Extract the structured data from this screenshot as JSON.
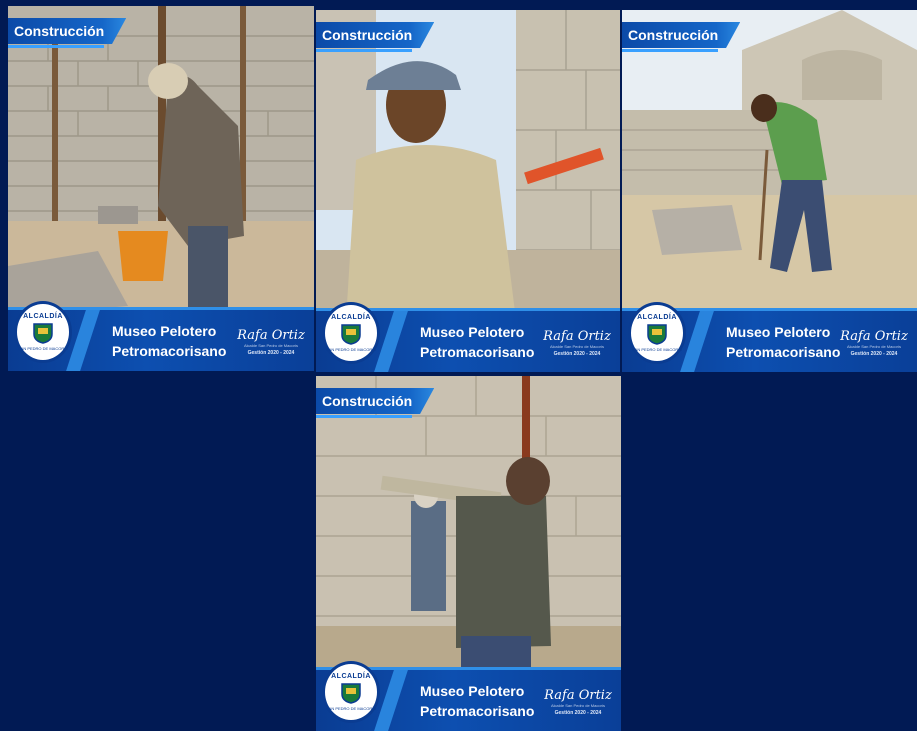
{
  "cards": [
    {
      "badge": "Construcción",
      "title_line1": "Museo Pelotero",
      "title_line2": "Petromacorisano",
      "seal_top": "ALCALDÍA",
      "seal_bottom": "SAN PEDRO DE MACORÍS",
      "signature": "Rafa Ortiz",
      "signature_role": "Alcalde San Pedro de Macorís",
      "term": "Gestión 2020 - 2024"
    },
    {
      "badge": "Construcción",
      "title_line1": "Museo Pelotero",
      "title_line2": "Petromacorisano",
      "seal_top": "ALCALDÍA",
      "seal_bottom": "SAN PEDRO DE MACORÍS",
      "signature": "Rafa Ortiz",
      "signature_role": "Alcalde San Pedro de Macorís",
      "term": "Gestión 2020 - 2024"
    },
    {
      "badge": "Construcción",
      "title_line1": "Museo Pelotero",
      "title_line2": "Petromacorisano",
      "seal_top": "ALCALDÍA",
      "seal_bottom": "SAN PEDRO DE MACORÍS",
      "signature": "Rafa Ortiz",
      "signature_role": "Alcalde San Pedro de Macorís",
      "term": "Gestión 2020 - 2024"
    },
    {
      "badge": "Construcción",
      "title_line1": "Museo Pelotero",
      "title_line2": "Petromacorisano",
      "seal_top": "ALCALDÍA",
      "seal_bottom": "SAN PEDRO DE MACORÍS",
      "signature": "Rafa Ortiz",
      "signature_role": "Alcalde San Pedro de Macorís",
      "term": "Gestión 2020 - 2024"
    }
  ],
  "colors": {
    "page_background": "#011a54",
    "brand_blue": "#0d4fb0",
    "accent_blue": "#2f8fe8"
  }
}
